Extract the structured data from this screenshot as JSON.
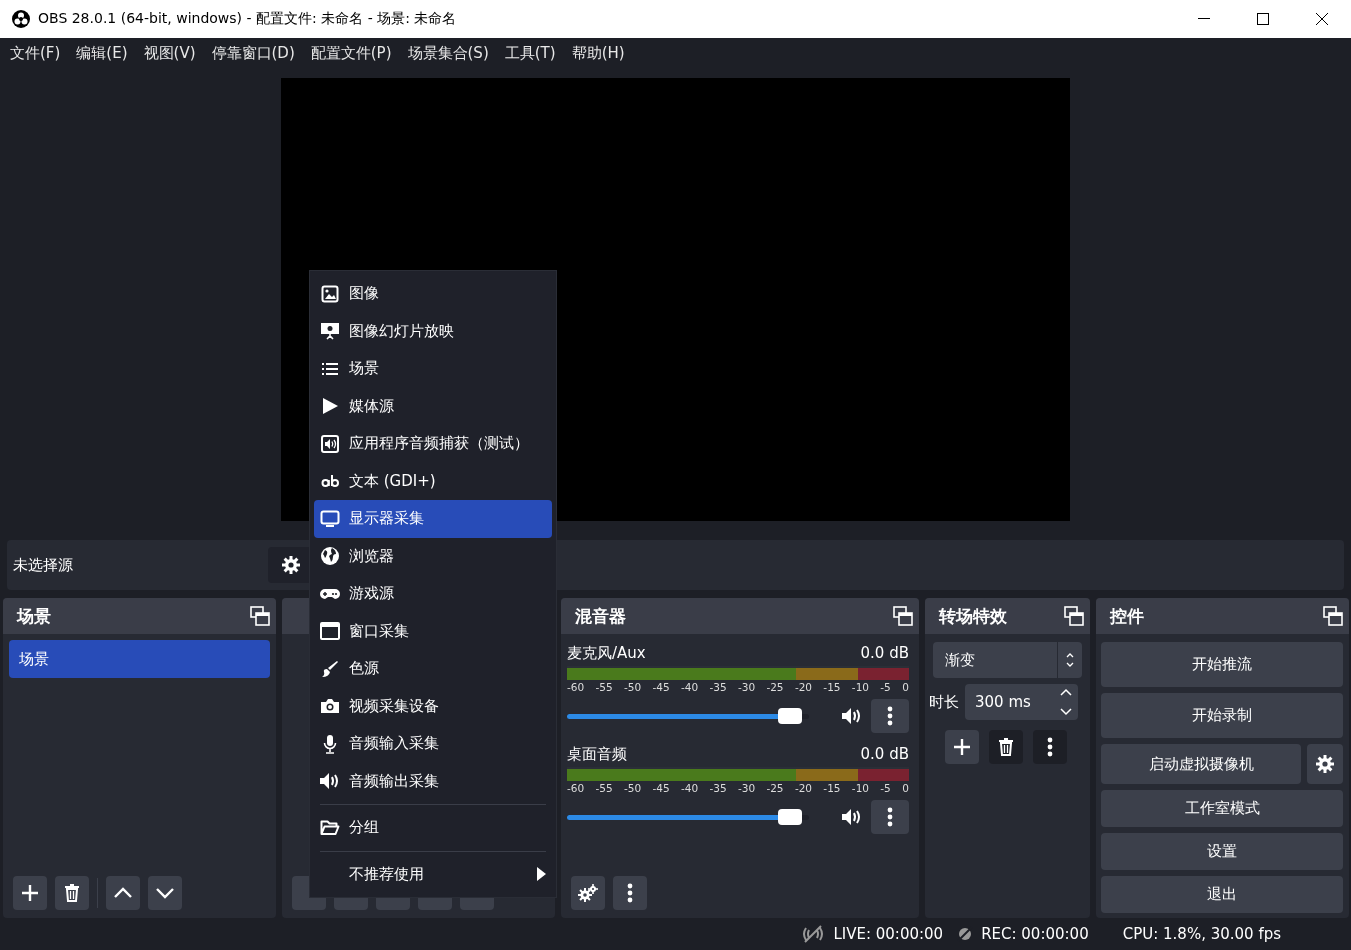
{
  "window": {
    "title": "OBS 28.0.1 (64-bit, windows) - 配置文件: 未命名 - 场景: 未命名"
  },
  "menu_bar": [
    "文件(F)",
    "编辑(E)",
    "视图(V)",
    "停靠窗口(D)",
    "配置文件(P)",
    "场景集合(S)",
    "工具(T)",
    "帮助(H)"
  ],
  "source_bar": {
    "status": "未选择源"
  },
  "scenes": {
    "title": "场景",
    "items": [
      {
        "label": "场景",
        "selected": true
      }
    ]
  },
  "mixer": {
    "title": "混音器",
    "channels": [
      {
        "name": "麦克风/Aux",
        "reading": "0.0 dB",
        "level": 0.97,
        "scale": [
          "-60",
          "-55",
          "-50",
          "-45",
          "-40",
          "-35",
          "-30",
          "-25",
          "-20",
          "-15",
          "-10",
          "-5",
          "0"
        ]
      },
      {
        "name": "桌面音频",
        "reading": "0.0 dB",
        "level": 0.97,
        "scale": [
          "-60",
          "-55",
          "-50",
          "-45",
          "-40",
          "-35",
          "-30",
          "-25",
          "-20",
          "-15",
          "-10",
          "-5",
          "0"
        ]
      }
    ]
  },
  "transitions": {
    "title": "转场特效",
    "transition": "渐变",
    "duration_label": "时长",
    "duration": "300 ms"
  },
  "controls": {
    "title": "控件",
    "buttons": [
      {
        "label": "开始推流",
        "has_settings": false
      },
      {
        "label": "开始录制",
        "has_settings": false
      },
      {
        "label": "启动虚拟摄像机",
        "has_settings": true
      },
      {
        "label": "工作室模式",
        "has_settings": false
      },
      {
        "label": "设置",
        "has_settings": false
      },
      {
        "label": "退出",
        "has_settings": false
      }
    ]
  },
  "context_menu": {
    "items": [
      {
        "kind": "item",
        "label": "图像",
        "selected": false
      },
      {
        "kind": "item",
        "label": "图像幻灯片放映",
        "selected": false
      },
      {
        "kind": "item",
        "label": "场景",
        "selected": false
      },
      {
        "kind": "item",
        "label": "媒体源",
        "selected": false
      },
      {
        "kind": "item",
        "label": "应用程序音频捕获（测试）",
        "selected": false
      },
      {
        "kind": "item",
        "label": "文本 (GDI+)",
        "selected": false
      },
      {
        "kind": "item",
        "label": "显示器采集",
        "selected": true
      },
      {
        "kind": "item",
        "label": "浏览器",
        "selected": false
      },
      {
        "kind": "item",
        "label": "游戏源",
        "selected": false
      },
      {
        "kind": "item",
        "label": "窗口采集",
        "selected": false
      },
      {
        "kind": "item",
        "label": "色源",
        "selected": false
      },
      {
        "kind": "item",
        "label": "视频采集设备",
        "selected": false
      },
      {
        "kind": "item",
        "label": "音频输入采集",
        "selected": false
      },
      {
        "kind": "item",
        "label": "音频输出采集",
        "selected": false
      },
      {
        "kind": "separator"
      },
      {
        "kind": "item",
        "label": "分组",
        "selected": false
      },
      {
        "kind": "separator"
      },
      {
        "kind": "submenu",
        "label": "不推荐使用",
        "selected": false
      }
    ]
  },
  "status_bar": {
    "live": "LIVE: 00:00:00",
    "rec": "REC: 00:00:00",
    "cpu": "CPU: 1.8%, 30.00 fps"
  }
}
